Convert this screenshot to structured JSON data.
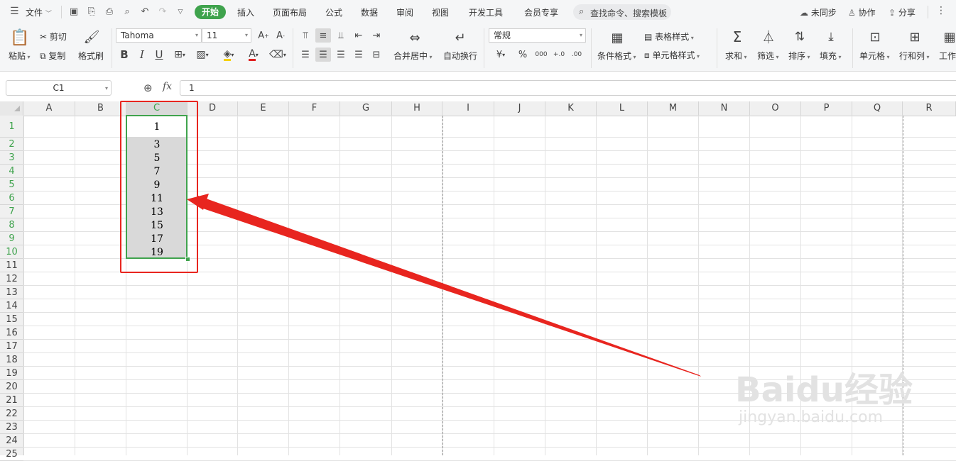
{
  "menubar": {
    "file_label": "文件",
    "tabs": [
      "开始",
      "插入",
      "页面布局",
      "公式",
      "数据",
      "审阅",
      "视图",
      "开发工具",
      "会员专享"
    ],
    "search_placeholder": "查找命令、搜索模板",
    "sync_label": "未同步",
    "collab_label": "协作",
    "share_label": "分享"
  },
  "ribbon": {
    "paste_label": "粘贴",
    "cut_label": "剪切",
    "copy_label": "复制",
    "format_painter_label": "格式刷",
    "font_name": "Tahoma",
    "font_size": "11",
    "merge_label": "合并居中",
    "wrap_label": "自动换行",
    "number_format": "常规",
    "cond_format_label": "条件格式",
    "table_style_label": "表格样式",
    "cell_style_label": "单元格样式",
    "sum_label": "求和",
    "filter_label": "筛选",
    "sort_label": "排序",
    "fill_label": "填充",
    "cell_label": "单元格",
    "rowcol_label": "行和列",
    "worksheet_label": "工作"
  },
  "formula_bar": {
    "name_box": "C1",
    "fx_label": "fx",
    "value": "1"
  },
  "columns": [
    "A",
    "B",
    "C",
    "D",
    "E",
    "F",
    "G",
    "H",
    "I",
    "J",
    "K",
    "L",
    "M",
    "N",
    "O",
    "P",
    "Q",
    "R"
  ],
  "rows": [
    "1",
    "2",
    "3",
    "4",
    "5",
    "6",
    "7",
    "8",
    "9",
    "10",
    "11",
    "12",
    "13",
    "14",
    "15",
    "16",
    "17",
    "18",
    "19",
    "20",
    "21",
    "22",
    "23",
    "24",
    "25"
  ],
  "cells_c": [
    "1",
    "3",
    "5",
    "7",
    "9",
    "11",
    "13",
    "15",
    "17",
    "19"
  ],
  "selection": "C1:C10",
  "colors": {
    "accent": "#3fa34d",
    "annotation": "#e8251f"
  },
  "watermark": {
    "brand": "Baidu经验",
    "url": "jingyan.baidu.com"
  }
}
